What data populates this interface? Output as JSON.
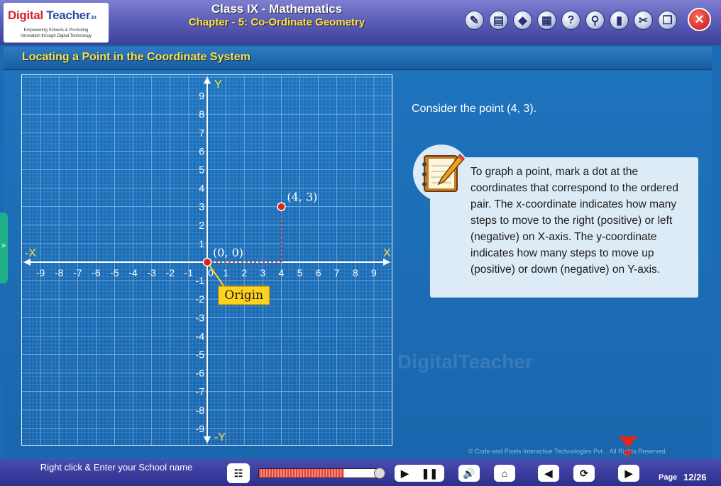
{
  "brand": {
    "title_part1": "Digital",
    "title_part2": "Teacher",
    "title_suffix": ".in",
    "tagline1": "Empowering Schools & Promoting",
    "tagline2": "Innovation through Digital Technology"
  },
  "header": {
    "line1": "Class IX - Mathematics",
    "line2": "Chapter - 5: Co-Ordinate Geometry"
  },
  "toolbar": {
    "icons": [
      "notes-icon",
      "book-icon",
      "blocks-icon",
      "glossary-icon",
      "help-icon",
      "search-icon",
      "pdf-icon",
      "tools-icon",
      "fullscreen-icon",
      "close-icon"
    ],
    "help_label": "?",
    "close_label": "✕"
  },
  "slide": {
    "title": "Locating a Point in the Coordinate System",
    "consider": "Consider the point (4, 3).",
    "note": "To graph a point, mark a dot at the coordinates that correspond to the ordered pair. The x-coordinate indicates how many steps to move to the right (positive) or left (negative) on X-axis. The y-coordinate indicates how many steps to move up (positive) or down (negative) on Y-axis.",
    "watermark": "DigitalTeacher"
  },
  "chart_data": {
    "type": "scatter",
    "xlabel": "X",
    "xlabel_neg": "-X",
    "ylabel": "Y",
    "ylabel_neg": "-Y",
    "xlim": [
      -9,
      9
    ],
    "ylim": [
      -9,
      9
    ],
    "xticks": [
      "-9",
      "-8",
      "-7",
      "-6",
      "-5",
      "-4",
      "-3",
      "-2",
      "-1",
      "0",
      "1",
      "2",
      "3",
      "4",
      "5",
      "6",
      "7",
      "8",
      "9"
    ],
    "yticks": [
      "9",
      "8",
      "7",
      "6",
      "5",
      "4",
      "3",
      "2",
      "1",
      "-1",
      "-2",
      "-3",
      "-4",
      "-5",
      "-6",
      "-7",
      "-8",
      "-9"
    ],
    "points": [
      {
        "x": 0,
        "y": 0,
        "label": "(0, 0)"
      },
      {
        "x": 4,
        "y": 3,
        "label": "(4, 3)"
      }
    ],
    "origin_label": "Origin",
    "grid": true,
    "point_color": "#d9261c"
  },
  "footer": {
    "school_prompt": "Right click & Enter your School name",
    "progress": 0.7,
    "page_label": "Page",
    "page_value": "12/26"
  },
  "copyright": "© Code and Pixels Interactive Technologies  Pvt.  . All Rights Reserved."
}
